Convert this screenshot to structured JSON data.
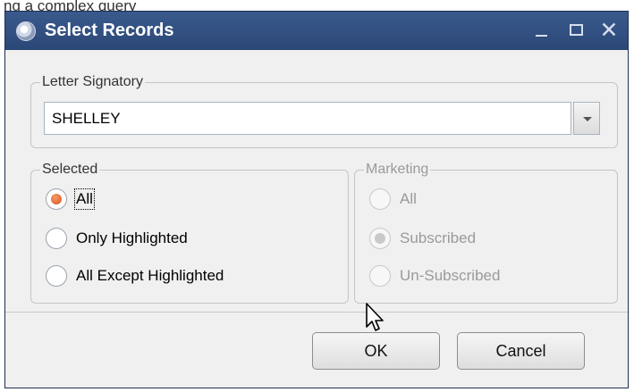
{
  "caption": "ng a complex query",
  "window": {
    "title": "Select Records",
    "close_glyph": "✕"
  },
  "signatory": {
    "label": "Letter Signatory",
    "value": "SHELLEY"
  },
  "selected": {
    "label": "Selected",
    "options": [
      "All",
      "Only Highlighted",
      "All Except Highlighted"
    ],
    "checked_index": 0
  },
  "marketing": {
    "label": "Marketing",
    "options": [
      "All",
      "Subscribed",
      "Un-Subscribed"
    ],
    "checked_index": 1,
    "enabled": false
  },
  "buttons": {
    "ok": "OK",
    "cancel": "Cancel"
  },
  "colors": {
    "titlebar": "#2f4b7c",
    "radio_accent": "#e0602a"
  },
  "icons": [
    "app-icon",
    "minimize-icon",
    "maximize-icon",
    "close-icon",
    "chevron-down-icon",
    "mouse-cursor-icon"
  ]
}
